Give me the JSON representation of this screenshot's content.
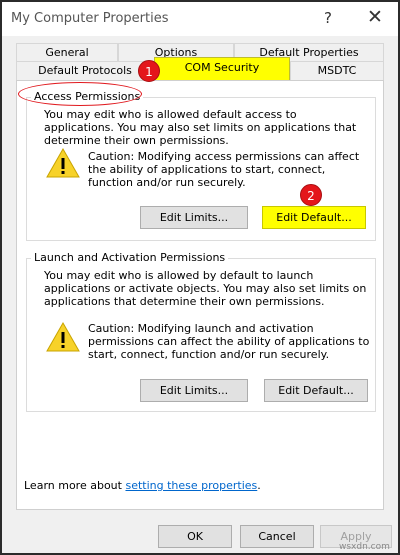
{
  "window": {
    "title": "My Computer Properties",
    "help": "?",
    "close": "✕"
  },
  "tabs": {
    "row_back": [
      "General",
      "Options",
      "Default Properties"
    ],
    "row_front": [
      "Default Protocols",
      "COM Security",
      "MSDTC"
    ],
    "active": "COM Security"
  },
  "access": {
    "legend": "Access Permissions",
    "description": "You may edit who is allowed default access to applications. You may also set limits on applications that determine their own permissions.",
    "caution": "Caution: Modifying access permissions can affect the ability of applications to start, connect, function and/or run securely.",
    "edit_limits": "Edit Limits...",
    "edit_default": "Edit Default..."
  },
  "launch": {
    "legend": "Launch and Activation Permissions",
    "description": "You may edit who is allowed by default to launch applications or activate objects. You may also set limits on applications that determine their own permissions.",
    "caution": "Caution: Modifying launch and activation permissions can affect the ability of applications to start, connect, function and/or run securely.",
    "edit_limits": "Edit Limits...",
    "edit_default": "Edit Default..."
  },
  "footer": {
    "prefix": "Learn more about ",
    "link": "setting these properties",
    "suffix": "."
  },
  "buttons": {
    "ok": "OK",
    "cancel": "Cancel",
    "apply": "Apply"
  },
  "annotations": {
    "badge1": "1",
    "badge2": "2",
    "badge_color": "#e4161b",
    "highlight_color": "#ffff00"
  },
  "watermark": "wsxdn.com"
}
